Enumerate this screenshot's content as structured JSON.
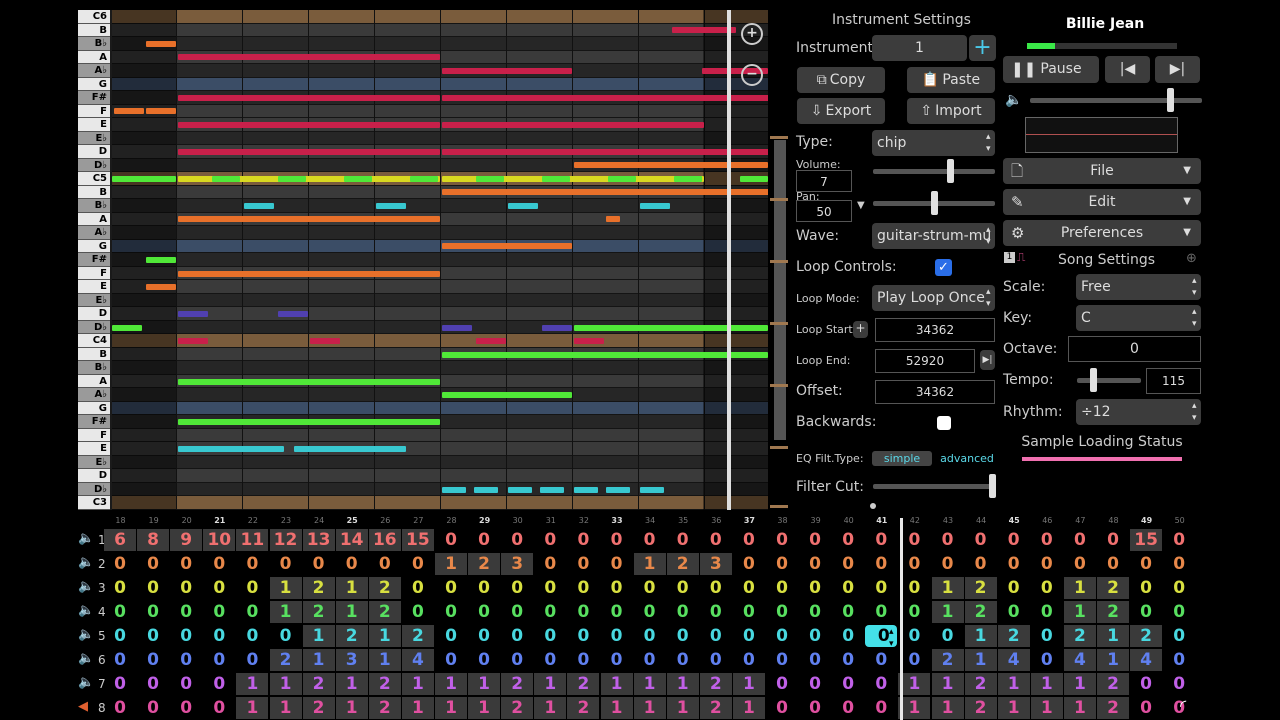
{
  "song": {
    "title": "Billie Jean"
  },
  "roll": {
    "keys": [
      "C6",
      "B",
      "B♭",
      "A",
      "A♭",
      "G",
      "F#",
      "F",
      "E",
      "E♭",
      "D",
      "D♭",
      "C5",
      "B",
      "B♭",
      "A",
      "A♭",
      "G",
      "F#",
      "F",
      "E",
      "E♭",
      "D",
      "D♭",
      "C4",
      "B",
      "B♭",
      "A",
      "A♭",
      "G",
      "F#",
      "F",
      "E",
      "E♭",
      "D",
      "D♭",
      "C3"
    ]
  },
  "instrument": {
    "heading": "Instrument Settings",
    "instrument_label": "Instrument:",
    "instrument_value": "1",
    "copy": "Copy",
    "paste": "Paste",
    "export": "Export",
    "import": "Import",
    "type_label": "Type:",
    "type_value": "chip",
    "volume_label": "Volume:",
    "volume_value": "7",
    "pan_label": "Pan:",
    "pan_value": "50",
    "wave_label": "Wave:",
    "wave_value": "guitar-strum-mu",
    "loop_controls_label": "Loop Controls:",
    "loop_mode_label": "Loop Mode:",
    "loop_mode_value": "Play Loop Once",
    "loop_start_label": "Loop Start:",
    "loop_start_value": "34362",
    "loop_end_label": "Loop End:",
    "loop_end_value": "52920",
    "offset_label": "Offset:",
    "offset_value": "34362",
    "backwards_label": "Backwards:",
    "eq_label": "EQ Filt.Type:",
    "eq_simple": "simple",
    "eq_advanced": "advanced",
    "filter_cut_label": "Filter Cut:"
  },
  "transport": {
    "pause": "Pause"
  },
  "menus": {
    "file": "File",
    "edit": "Edit",
    "preferences": "Preferences"
  },
  "song_settings": {
    "heading": "Song Settings",
    "scale_label": "Scale:",
    "scale_value": "Free",
    "key_label": "Key:",
    "key_value": "C",
    "octave_label": "Octave:",
    "octave_value": "0",
    "tempo_label": "Tempo:",
    "tempo_value": "115",
    "rhythm_label": "Rhythm:",
    "rhythm_value": "÷12",
    "sample_status": "Sample Loading Status"
  },
  "pattern": {
    "bars": [
      "18",
      "19",
      "20",
      "21",
      "22",
      "23",
      "24",
      "25",
      "26",
      "27",
      "28",
      "29",
      "30",
      "31",
      "32",
      "33",
      "34",
      "35",
      "36",
      "37",
      "38",
      "39",
      "40",
      "41",
      "42",
      "43",
      "44",
      "45",
      "46",
      "47",
      "48",
      "49",
      "50"
    ],
    "bold_bars": [
      "21",
      "25",
      "29",
      "33",
      "37",
      "41",
      "45",
      "49"
    ],
    "channel_colors": [
      "#f07070",
      "#e8884a",
      "#d8e040",
      "#58e060",
      "#48d8e0",
      "#6080f0",
      "#c060e8",
      "#e050a0"
    ],
    "channels": [
      [
        "6",
        "8",
        "9",
        "10",
        "11",
        "12",
        "13",
        "14",
        "16",
        "15",
        "0",
        "0",
        "0",
        "0",
        "0",
        "0",
        "0",
        "0",
        "0",
        "0",
        "0",
        "0",
        "0",
        "0",
        "0",
        "0",
        "0",
        "0",
        "0",
        "0",
        "0",
        "15",
        "0"
      ],
      [
        "0",
        "0",
        "0",
        "0",
        "0",
        "0",
        "0",
        "0",
        "0",
        "0",
        "1",
        "2",
        "3",
        "0",
        "0",
        "0",
        "1",
        "2",
        "3",
        "0",
        "0",
        "0",
        "0",
        "0",
        "0",
        "0",
        "0",
        "0",
        "0",
        "0",
        "0",
        "0",
        "0"
      ],
      [
        "0",
        "0",
        "0",
        "0",
        "0",
        "1",
        "2",
        "1",
        "2",
        "0",
        "0",
        "0",
        "0",
        "0",
        "0",
        "0",
        "0",
        "0",
        "0",
        "0",
        "0",
        "0",
        "0",
        "0",
        "0",
        "1",
        "2",
        "0",
        "0",
        "1",
        "2",
        "0",
        "0"
      ],
      [
        "0",
        "0",
        "0",
        "0",
        "0",
        "1",
        "2",
        "1",
        "2",
        "0",
        "0",
        "0",
        "0",
        "0",
        "0",
        "0",
        "0",
        "0",
        "0",
        "0",
        "0",
        "0",
        "0",
        "0",
        "0",
        "1",
        "2",
        "0",
        "0",
        "1",
        "2",
        "0",
        "0"
      ],
      [
        "0",
        "0",
        "0",
        "0",
        "0",
        "0",
        "1",
        "2",
        "1",
        "2",
        "0",
        "0",
        "0",
        "0",
        "0",
        "0",
        "0",
        "0",
        "0",
        "0",
        "0",
        "0",
        "0",
        "0",
        "0",
        "0",
        "1",
        "2",
        "0",
        "2",
        "1",
        "2",
        "0"
      ],
      [
        "0",
        "0",
        "0",
        "0",
        "0",
        "2",
        "1",
        "3",
        "1",
        "4",
        "0",
        "0",
        "0",
        "0",
        "0",
        "0",
        "0",
        "0",
        "0",
        "0",
        "0",
        "0",
        "0",
        "0",
        "0",
        "2",
        "1",
        "4",
        "0",
        "4",
        "1",
        "4",
        "0"
      ],
      [
        "0",
        "0",
        "0",
        "0",
        "1",
        "1",
        "2",
        "1",
        "2",
        "1",
        "1",
        "1",
        "2",
        "1",
        "2",
        "1",
        "1",
        "1",
        "2",
        "1",
        "0",
        "0",
        "0",
        "0",
        "1",
        "1",
        "2",
        "1",
        "1",
        "1",
        "2",
        "0",
        "0"
      ],
      [
        "0",
        "0",
        "0",
        "0",
        "1",
        "1",
        "2",
        "1",
        "2",
        "1",
        "1",
        "1",
        "2",
        "1",
        "2",
        "1",
        "1",
        "1",
        "2",
        "1",
        "0",
        "0",
        "0",
        "0",
        "1",
        "1",
        "2",
        "1",
        "1",
        "1",
        "2",
        "0",
        "0"
      ]
    ]
  }
}
